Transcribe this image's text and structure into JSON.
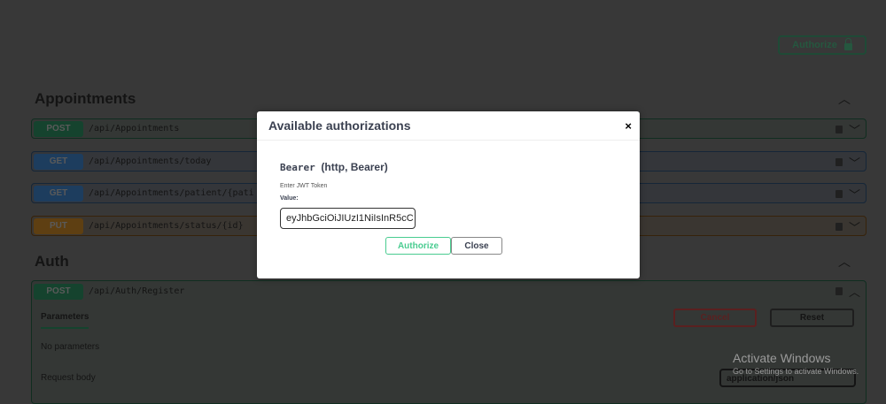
{
  "topbar": {
    "authorize_label": "Authorize"
  },
  "sections": [
    {
      "title": "Appointments",
      "ops": [
        {
          "method": "POST",
          "path": "/api/Appointments",
          "color": "#49cc90"
        },
        {
          "method": "GET",
          "path": "/api/Appointments/today",
          "color": "#61affe"
        },
        {
          "method": "GET",
          "path": "/api/Appointments/patient/{patientId}",
          "color": "#61affe"
        },
        {
          "method": "PUT",
          "path": "/api/Appointments/status/{id}",
          "color": "#fca130"
        }
      ]
    },
    {
      "title": "Auth",
      "ops": [
        {
          "method": "POST",
          "path": "/api/Auth/Register",
          "color": "#49cc90"
        }
      ]
    }
  ],
  "expanded": {
    "tab": "Parameters",
    "cancel": "Cancel",
    "reset": "Reset",
    "no_params": "No parameters",
    "request_body": "Request body",
    "content_type": "application/json"
  },
  "modal": {
    "title": "Available authorizations",
    "close_x": "×",
    "scheme_name": "Bearer",
    "scheme_type": "(http, Bearer)",
    "description": "Enter JWT Token",
    "value_label": "Value:",
    "value": "eyJhbGciOiJIUzI1NiIsInR5cC",
    "authorize": "Authorize",
    "close": "Close"
  },
  "watermark": {
    "title": "Activate Windows",
    "subtitle": "Go to Settings to activate Windows."
  }
}
